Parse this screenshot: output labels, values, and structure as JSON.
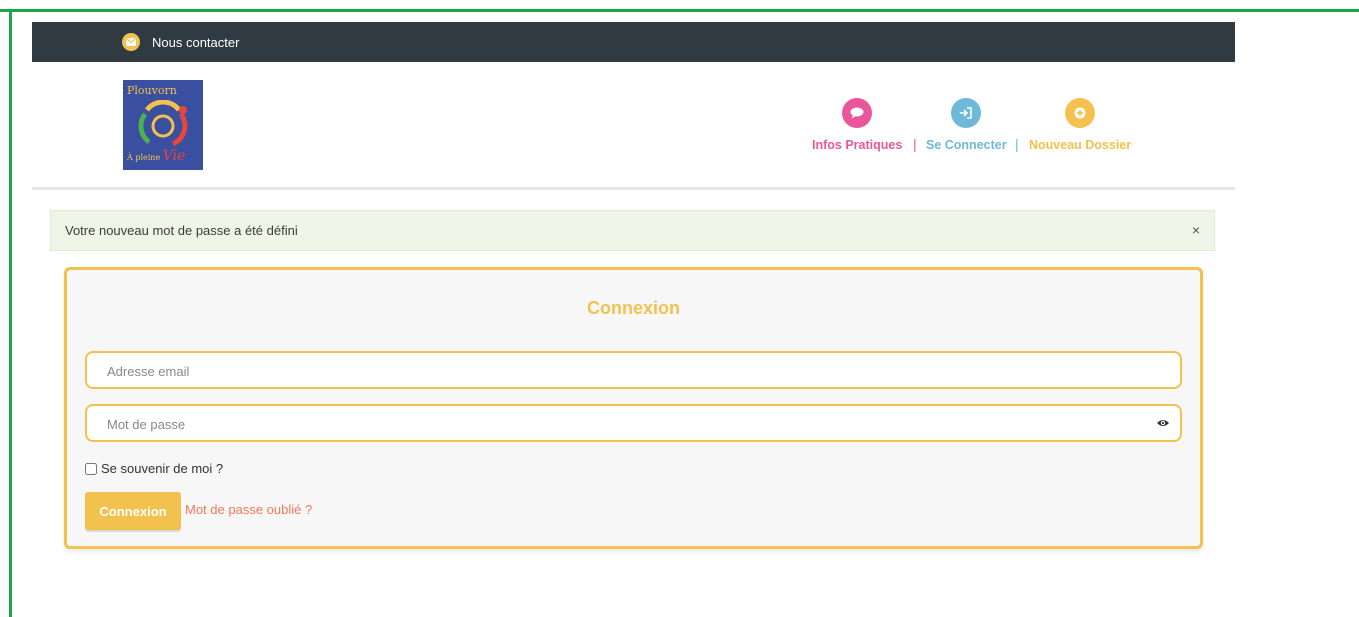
{
  "topbar": {
    "contact_label": "Nous contacter",
    "contact_icon": "envelope-icon"
  },
  "logo": {
    "line1": "Plouvorn",
    "line2": "À pleine",
    "accent": "Vie"
  },
  "nav": [
    {
      "label": "Infos Pratiques",
      "icon": "speech-bubble-icon",
      "color": "#e9579a"
    },
    {
      "label": "Se Connecter",
      "icon": "sign-in-icon",
      "color": "#6fb8d8"
    },
    {
      "label": "Nouveau Dossier",
      "icon": "plus-circle-icon",
      "color": "#f2c14e"
    }
  ],
  "nav_separator": "|",
  "alert": {
    "message": "Votre nouveau mot de passe a été défini",
    "close": "×"
  },
  "login": {
    "title": "Connexion",
    "email_placeholder": "Adresse email",
    "password_placeholder": "Mot de passe",
    "remember_label": "Se souvenir de moi ?",
    "submit_label": "Connexion",
    "forgot_label": "Mot de passe oublié ?"
  },
  "colors": {
    "accent": "#f2c14e",
    "topbar": "#2f3a42",
    "frame": "#1aa64a",
    "link": "#f07a5a"
  }
}
